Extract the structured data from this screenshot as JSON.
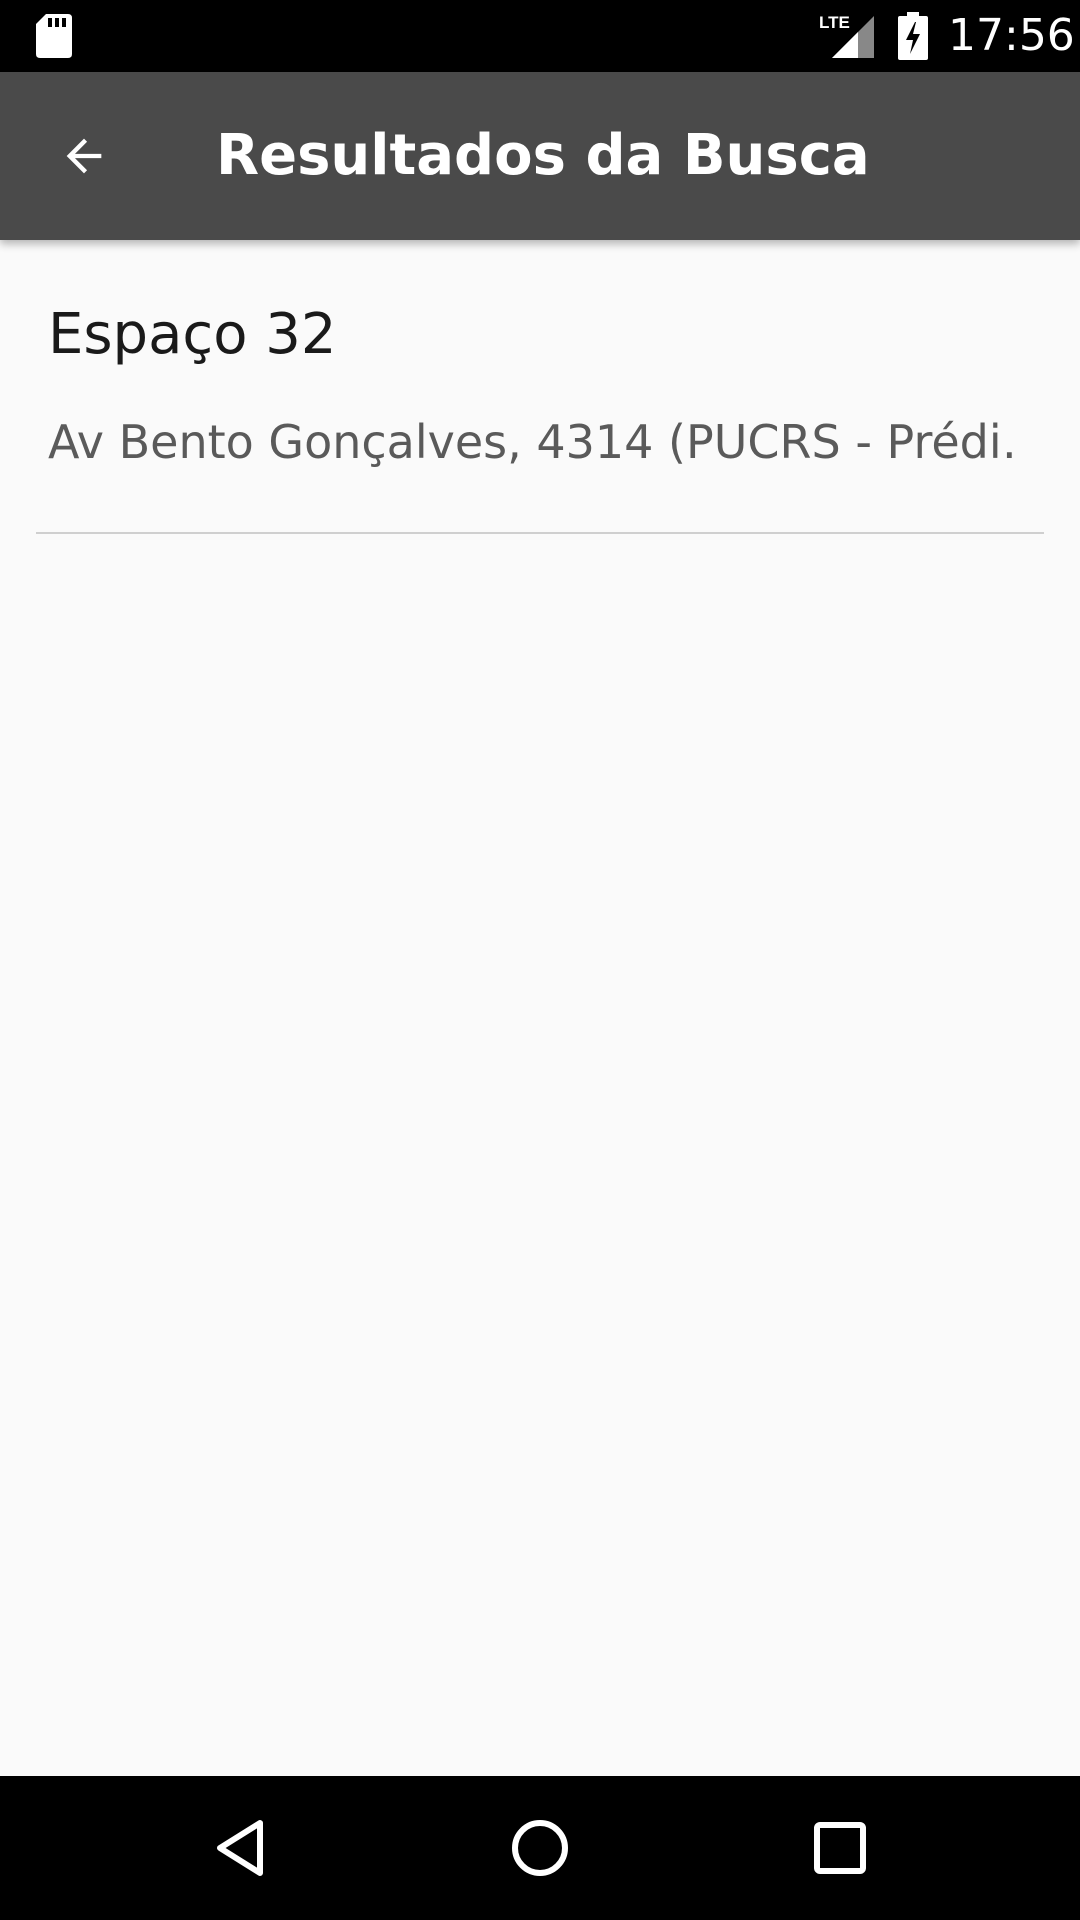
{
  "status_bar": {
    "time": "17:56",
    "network_label": "LTE",
    "icons": [
      "sd-card-icon",
      "lte-signal-icon",
      "battery-charging-icon"
    ]
  },
  "app_bar": {
    "title": "Resultados da Busca",
    "back_icon": "arrow-back-icon",
    "background_color": "#4a4a4a"
  },
  "results": [
    {
      "title": "Espaço 32",
      "address": "Av Bento Gonçalves, 4314 (PUCRS - Prédi…"
    }
  ],
  "nav_bar": {
    "icons": [
      "nav-back-icon",
      "nav-home-icon",
      "nav-recents-icon"
    ]
  }
}
